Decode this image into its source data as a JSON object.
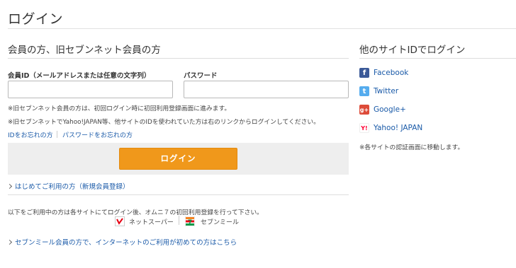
{
  "page": {
    "title": "ログイン"
  },
  "member_section": {
    "title": "会員の方、旧セブンネット会員の方",
    "member_id_label": "会員ID（メールアドレスまたは任意の文字列）",
    "member_id_value": "",
    "password_label": "パスワード",
    "password_value": "",
    "notes": [
      "※旧セブンネット会員の方は、初回ログイン時に初回利用登録画面に進みます。",
      "※旧セブンネットでYahoo!JAPAN等、他サイトのIDを使われていた方は右のリンクからログインしてください。"
    ],
    "forgot_id_link": "IDをお忘れの方",
    "forgot_password_link": "パスワードをお忘れの方",
    "login_button": "ログイン",
    "first_time_link": "はじめてご利用の方（新規会員登録）"
  },
  "other_services": {
    "note": "以下をご利用中の方は各サイトにてログイン後、オムニ７の初回利用登録を行って下さい。",
    "brands": [
      {
        "name": "ネットスーパー",
        "icon": "netsuper-logo",
        "color": "#e60012"
      },
      {
        "name": "セブンミール",
        "icon": "seven-meal-logo",
        "color": "#0a9a48"
      }
    ],
    "seven_meal_link": "セブンミール会員の方で、インターネットのご利用が初めての方はこちら"
  },
  "social_section": {
    "title": "他のサイトIDでログイン",
    "providers": [
      {
        "name": "Facebook",
        "icon": "facebook-icon",
        "glyph": "f",
        "color": "#3b5998"
      },
      {
        "name": "Twitter",
        "icon": "twitter-icon",
        "glyph": "t",
        "color": "#55acee"
      },
      {
        "name": "Google+",
        "icon": "google-plus-icon",
        "glyph": "g+",
        "color": "#dd4b39"
      },
      {
        "name": "Yahoo! JAPAN",
        "icon": "yahoo-japan-icon",
        "glyph": "Y!",
        "color": "#ff0033"
      }
    ],
    "note": "※各サイトの認証画面に移動します。"
  }
}
